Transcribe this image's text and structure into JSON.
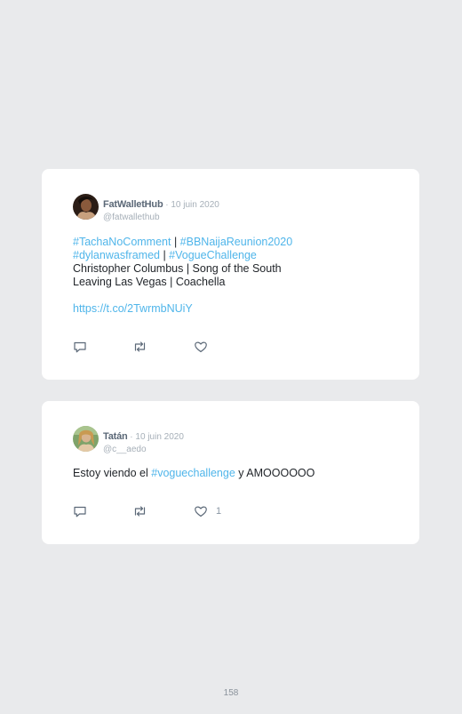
{
  "tweets": [
    {
      "name": "FatWalletHub",
      "date": "10 juin 2020",
      "handle": "@fatwallethub",
      "line1": {
        "t1": "#TachaNoComment",
        "sep": " | ",
        "t2": "#BBNaijaReunion2020"
      },
      "line2": {
        "t1": "#dylanwasframed",
        "sep": " | ",
        "t2": "#VogueChallenge"
      },
      "line3": "Christopher Columbus | Song of the South",
      "line4": "Leaving Las Vegas | Coachella",
      "link": "https://t.co/2TwrmbNUiY",
      "actions": {
        "reply_icon": "reply-icon",
        "retweet_icon": "retweet-icon",
        "like_icon": "heart-icon",
        "like_count": ""
      }
    },
    {
      "name": "Tatán",
      "date": "10 juin 2020",
      "handle": "@c__aedo",
      "text_before": "Estoy viendo el ",
      "tag": "#voguechallenge",
      "text_after": " y AMOOOOOO",
      "actions": {
        "reply_icon": "reply-icon",
        "retweet_icon": "retweet-icon",
        "like_icon": "heart-icon",
        "like_count": "1"
      }
    }
  ],
  "meta_separator": " · ",
  "page_number": "158",
  "colors": {
    "background": "#e9eaec",
    "card": "#ffffff",
    "hashtag": "#4fb5ea",
    "name": "#5b6877",
    "muted": "#a6afb8"
  }
}
